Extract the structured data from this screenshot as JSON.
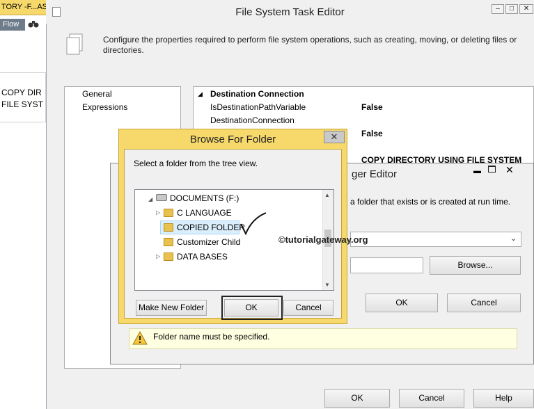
{
  "background": {
    "tab_title": "TORY -F...AS",
    "flow_label": "Flow",
    "task_lines": [
      "COPY DIR",
      "FILE SYST"
    ]
  },
  "main_dialog": {
    "title": "File System Task Editor",
    "description": "Configure the properties required to perform file system operations, such as creating, moving, or deleting files or directories.",
    "nav_items": [
      "General",
      "Expressions"
    ],
    "property_category": "Destination Connection",
    "properties": [
      {
        "name": "IsDestinationPathVariable",
        "value": "False"
      },
      {
        "name": "DestinationConnection",
        "value": ""
      },
      {
        "name": "",
        "value": "False"
      },
      {
        "name": "",
        "value": "COPY DIRECTORY USING FILE SYSTEM TASK"
      }
    ],
    "buttons": {
      "ok": "OK",
      "cancel": "Cancel",
      "help": "Help"
    }
  },
  "connection_editor": {
    "title": "ger Editor",
    "description": "a folder that exists or is created at run time.",
    "selected_option": "",
    "path_value": "",
    "browse_label": "Browse...",
    "ok_label": "OK",
    "cancel_label": "Cancel",
    "warning": "Folder name must be specified."
  },
  "browse_dialog": {
    "title": "Browse For Folder",
    "close_glyph": "✕",
    "instruction": "Select a folder from the tree view.",
    "tree": [
      {
        "label": "DOCUMENTS (F:)",
        "type": "drive",
        "expanded": true
      },
      {
        "label": "C LANGUAGE",
        "type": "folder",
        "expandable": true
      },
      {
        "label": "COPIED FOLDER",
        "type": "folder",
        "selected": true
      },
      {
        "label": "Customizer Child",
        "type": "folder"
      },
      {
        "label": "DATA BASES",
        "type": "folder",
        "expandable": true
      }
    ],
    "buttons": {
      "new_folder": "Make New Folder",
      "ok": "OK",
      "cancel": "Cancel"
    }
  },
  "watermark": "©tutorialgateway.org",
  "colors": {
    "browse_frame": "#f6d96a",
    "selection": "#dbeefc",
    "warning_bg": "#ffffe1",
    "folder": "#e8c24c"
  }
}
